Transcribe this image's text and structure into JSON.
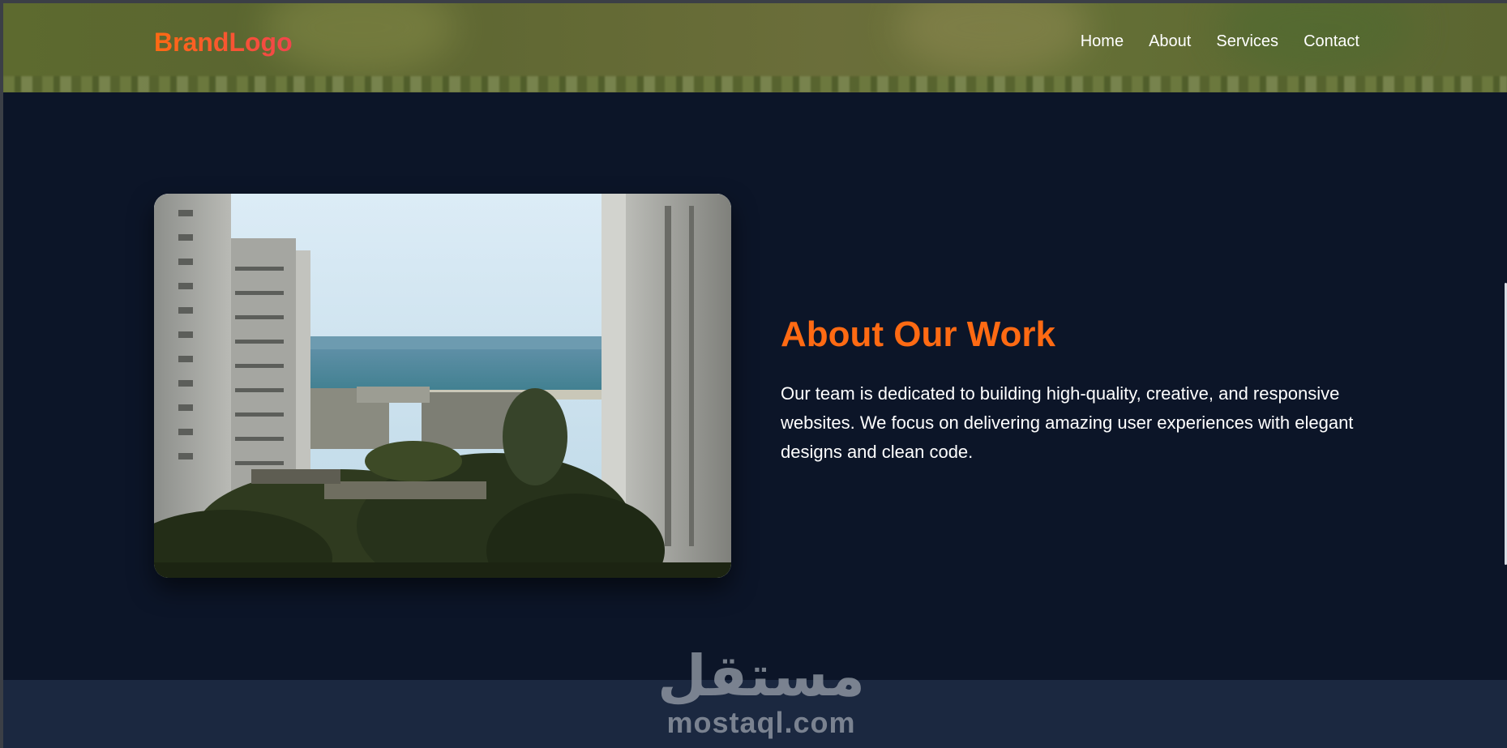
{
  "header": {
    "brand": "BrandLogo",
    "nav": [
      {
        "label": "Home"
      },
      {
        "label": "About"
      },
      {
        "label": "Services"
      },
      {
        "label": "Contact"
      }
    ]
  },
  "about": {
    "title": "About Our Work",
    "body": "Our team is dedicated to building high-quality, creative, and responsive websites. We focus on delivering amazing user experiences with elegant designs and clean code."
  },
  "watermark": {
    "arabic": "مستقل",
    "latin": "mostaql.com"
  },
  "colors": {
    "accent": "#ff6a13",
    "background": "#0c1528",
    "footer": "#1b2840"
  }
}
